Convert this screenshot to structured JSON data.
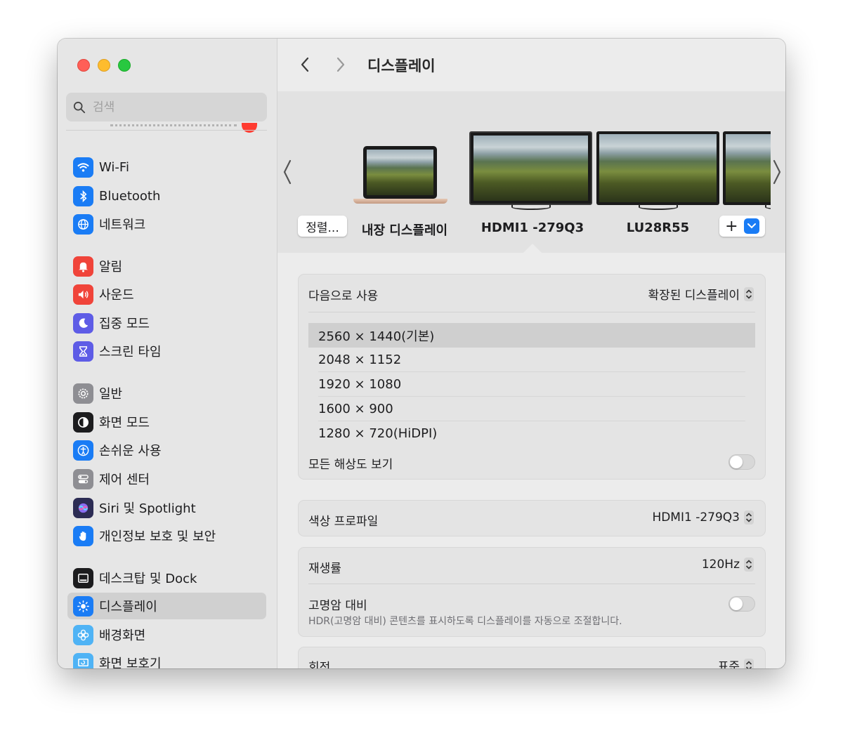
{
  "window": {
    "traffic_lights": [
      "close",
      "minimize",
      "zoom"
    ]
  },
  "search": {
    "placeholder": "검색"
  },
  "sidebar": {
    "items": [
      {
        "label": "Wi-Fi",
        "icon": "wifi-icon",
        "color": "#1a7cf5"
      },
      {
        "label": "Bluetooth",
        "icon": "bluetooth-icon",
        "color": "#1a7cf5"
      },
      {
        "label": "네트워크",
        "icon": "globe-icon",
        "color": "#1a7cf5"
      },
      {
        "label": "알림",
        "icon": "bell-icon",
        "color": "#f0443a"
      },
      {
        "label": "사운드",
        "icon": "speaker-icon",
        "color": "#f0443a"
      },
      {
        "label": "집중 모드",
        "icon": "moon-icon",
        "color": "#5e5ce6"
      },
      {
        "label": "스크린 타임",
        "icon": "hourglass-icon",
        "color": "#5e5ce6"
      },
      {
        "label": "일반",
        "icon": "gear-icon",
        "color": "#8e8e93"
      },
      {
        "label": "화면 모드",
        "icon": "appearance-icon",
        "color": "#1c1c1e"
      },
      {
        "label": "손쉬운 사용",
        "icon": "accessibility-icon",
        "color": "#1a7cf5"
      },
      {
        "label": "제어 센터",
        "icon": "control-center-icon",
        "color": "#8e8e93"
      },
      {
        "label": "Siri 및 Spotlight",
        "icon": "siri-icon",
        "color": "#2c2c54"
      },
      {
        "label": "개인정보 보호 및 보안",
        "icon": "hand-icon",
        "color": "#1a7cf5"
      },
      {
        "label": "데스크탑 및 Dock",
        "icon": "dock-icon",
        "color": "#1c1c1e"
      },
      {
        "label": "디스플레이",
        "icon": "sun-icon",
        "color": "#1a7cf5",
        "selected": true
      },
      {
        "label": "배경화면",
        "icon": "flower-icon",
        "color": "#4fb3f5"
      },
      {
        "label": "화면 보호기",
        "icon": "screensaver-icon",
        "color": "#4fb3f5"
      }
    ]
  },
  "header": {
    "title": "디스플레이"
  },
  "arrangement": {
    "arrange_button": "정렬...",
    "displays": [
      {
        "label": "내장 디스플레이"
      },
      {
        "label": "HDMI1 -279Q3",
        "selected": true
      },
      {
        "label": "LU28R55"
      }
    ],
    "add_button": "+"
  },
  "settings": {
    "use_as": {
      "label": "다음으로 사용",
      "value": "확장된 디스플레이"
    },
    "resolutions": [
      {
        "label": "2560 × 1440(기본)",
        "selected": true
      },
      {
        "label": "2048 × 1152"
      },
      {
        "label": "1920 × 1080"
      },
      {
        "label": "1600 × 900"
      },
      {
        "label": "1280 × 720(HiDPI)"
      }
    ],
    "show_all": {
      "label": "모든 해상도 보기",
      "on": false
    },
    "color_profile": {
      "label": "색상 프로파일",
      "value": "HDMI1 -279Q3"
    },
    "refresh_rate": {
      "label": "재생률",
      "value": "120Hz"
    },
    "hdr": {
      "label": "고명암 대비",
      "description": "HDR(고명암 대비) 콘텐츠를 표시하도록 디스플레이를 자동으로 조절합니다.",
      "on": false
    },
    "rotation": {
      "label": "회전",
      "value": "표준"
    }
  },
  "colors": {
    "accent": "#1a7cf5"
  }
}
